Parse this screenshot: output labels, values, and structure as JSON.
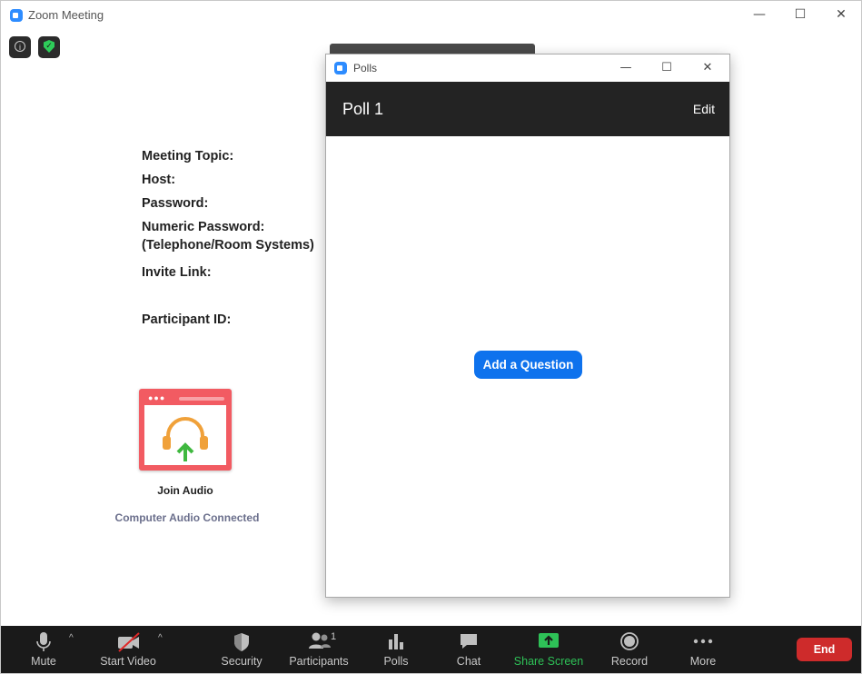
{
  "main_window": {
    "title": "Zoom Meeting",
    "controls": {
      "minimize": "—",
      "maximize": "☐",
      "close": "✕"
    }
  },
  "meeting_info": {
    "topic_label": "Meeting Topic:",
    "host_label": "Host:",
    "password_label": "Password:",
    "numeric_password_label": "Numeric Password:",
    "numeric_password_sub": "(Telephone/Room Systems)",
    "invite_link_label": "Invite Link:",
    "participant_id_label": "Participant ID:"
  },
  "audio": {
    "join_label": "Join Audio",
    "status": "Computer Audio Connected"
  },
  "polls_window": {
    "title": "Polls",
    "poll_name": "Poll 1",
    "edit_label": "Edit",
    "add_question_label": "Add a Question"
  },
  "toolbar": {
    "mute": "Mute",
    "start_video": "Start Video",
    "security": "Security",
    "participants": "Participants",
    "participants_count": "1",
    "polls": "Polls",
    "chat": "Chat",
    "share_screen": "Share Screen",
    "record": "Record",
    "more": "More",
    "end": "End"
  },
  "colors": {
    "accent_blue": "#0e72ed",
    "share_green": "#2ec157",
    "end_red": "#ce2b2b",
    "toolbar_bg": "#1a1a1a",
    "poll_header_bg": "#232323"
  }
}
